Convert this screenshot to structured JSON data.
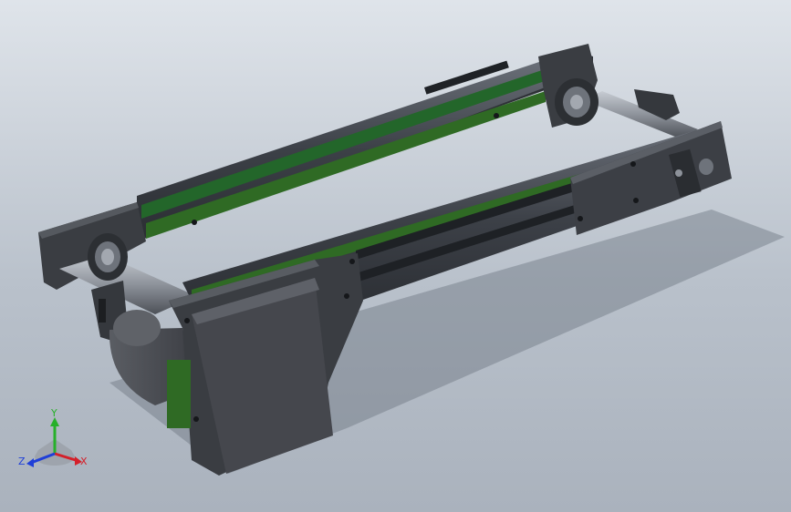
{
  "scene": {
    "background_top": "#dfe4ea",
    "background_bottom": "#aab2bd",
    "frame_color": "#3a3d42",
    "belt_color": "#2f6a24",
    "rail_color": "#4a4e55",
    "motor_color": "#45474d",
    "shaft_color": "#8d929a"
  },
  "triad": {
    "x_label": "X",
    "y_label": "Y",
    "z_label": "Z",
    "x_color": "#d4202a",
    "y_color": "#27b02a",
    "z_color": "#1f3fd8"
  }
}
